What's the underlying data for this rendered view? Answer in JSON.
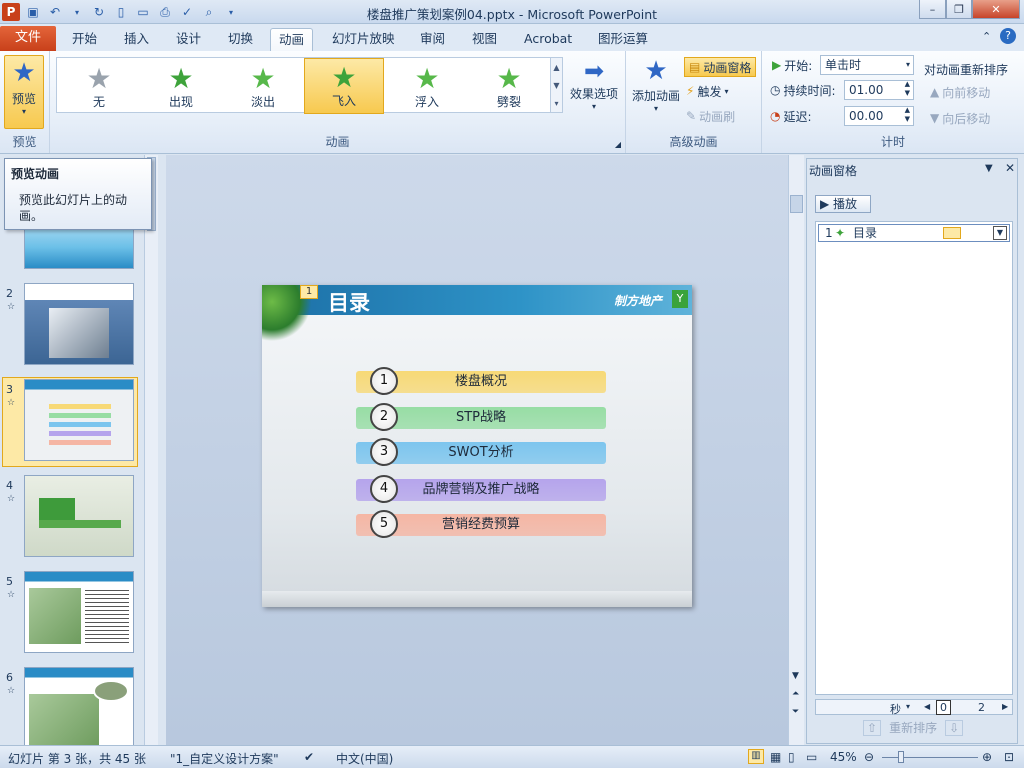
{
  "window": {
    "title": "楼盘推广策划案例04.pptx  -  Microsoft PowerPoint",
    "app_icon": "P"
  },
  "tabs": [
    {
      "label": "文件"
    },
    {
      "label": "开始"
    },
    {
      "label": "插入"
    },
    {
      "label": "设计"
    },
    {
      "label": "切换"
    },
    {
      "label": "动画"
    },
    {
      "label": "幻灯片放映"
    },
    {
      "label": "审阅"
    },
    {
      "label": "视图"
    },
    {
      "label": "Acrobat"
    },
    {
      "label": "图形运算"
    }
  ],
  "ribbon": {
    "preview": {
      "label": "预览",
      "group": "预览"
    },
    "animations": {
      "group": "动画",
      "items": [
        {
          "label": "无"
        },
        {
          "label": "出现"
        },
        {
          "label": "淡出"
        },
        {
          "label": "飞入"
        },
        {
          "label": "浮入"
        },
        {
          "label": "劈裂"
        }
      ],
      "effect_options": "效果选项"
    },
    "advanced": {
      "group": "高级动画",
      "add": "添加动画",
      "pane": "动画窗格",
      "trigger": "触发",
      "painter": "动画刷"
    },
    "timing": {
      "group": "计时",
      "start_label": "开始:",
      "start_value": "单击时",
      "duration_label": "持续时间:",
      "duration_value": "01.00",
      "delay_label": "延迟:",
      "delay_value": "00.00",
      "reorder": "对动画重新排序",
      "move_earlier": "向前移动",
      "move_later": "向后移动"
    }
  },
  "tooltip": {
    "title": "预览动画",
    "body": "预览此幻灯片上的动画。"
  },
  "thumbnails": [
    {
      "num": "2"
    },
    {
      "num": "3"
    },
    {
      "num": "4"
    },
    {
      "num": "5"
    },
    {
      "num": "6"
    }
  ],
  "slide": {
    "badge": "1",
    "title": "目录",
    "logo": "制方地产",
    "items": [
      {
        "num": "1",
        "label": "楼盘概况",
        "color": "#f7d976"
      },
      {
        "num": "2",
        "label": "STP战略",
        "color": "#97dda4"
      },
      {
        "num": "3",
        "label": "SWOT分析",
        "color": "#7cc5ee"
      },
      {
        "num": "4",
        "label": "品牌营销及推广战略",
        "color": "#b5a4ec"
      },
      {
        "num": "5",
        "label": "营销经费预算",
        "color": "#f5b6a4"
      }
    ]
  },
  "anim_pane": {
    "title": "动画窗格",
    "play": "播放",
    "item_num": "1",
    "item_label": "目录",
    "seconds": "秒",
    "timeline_0": "0",
    "timeline_2": "2",
    "reorder": "重新排序"
  },
  "status": {
    "slide_info": "幻灯片 第 3 张，共 45 张",
    "theme": "\"1_自定义设计方案\"",
    "language": "中文(中国)",
    "zoom": "45%"
  }
}
